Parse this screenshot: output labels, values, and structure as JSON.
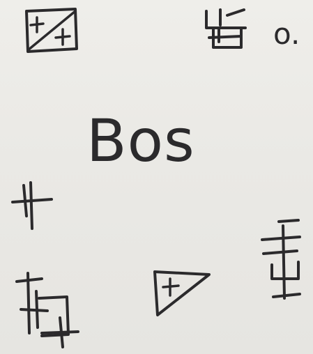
{
  "page": {
    "background": "#ecebe7",
    "ink_color": "#2b2a2c"
  },
  "text": {
    "word": "Bos",
    "corner_mark": "o."
  },
  "symbols": [
    "square-with-diagonal-and-two-plus-signs",
    "hooked-cross-glyph",
    "crossed-line-glyph",
    "box-with-crossed-lines-glyph",
    "triangle-with-plus-sign",
    "stacked-hooked-glyph"
  ]
}
